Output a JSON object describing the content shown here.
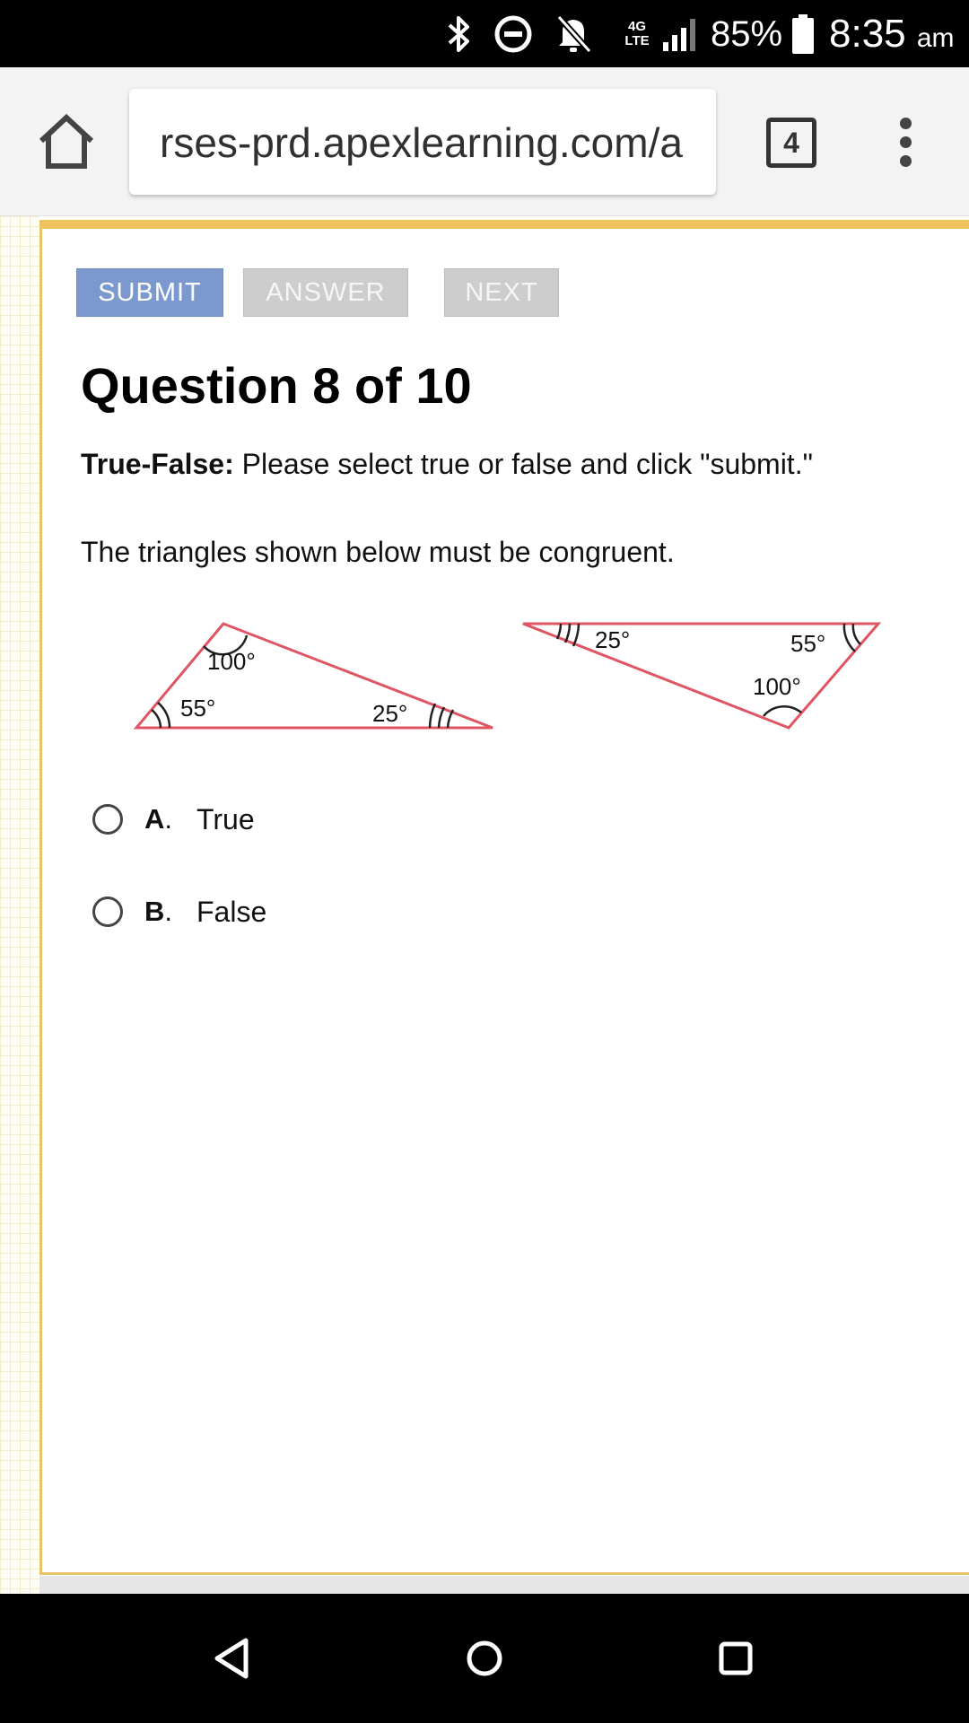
{
  "status_bar": {
    "network": "4G LTE",
    "battery": "85%",
    "time": "8:35",
    "ampm": "am"
  },
  "browser": {
    "url": "rses-prd.apexlearning.com/a",
    "tab_count": "4"
  },
  "toolbar": {
    "submit_label": "SUBMIT",
    "answer_label": "ANSWER",
    "next_label": "NEXT"
  },
  "question": {
    "title": "Question 8 of 10",
    "instruction_label": "True-False:",
    "instruction_text": " Please select true or false and click \"submit.\"",
    "prompt": "The triangles shown below must be congruent."
  },
  "figure": {
    "triangle_1": {
      "top_angle": "100°",
      "left_angle": "55°",
      "right_angle": "25°"
    },
    "triangle_2": {
      "left_angle": "25°",
      "right_angle": "55°",
      "bottom_angle": "100°"
    },
    "line_color": "#e05563"
  },
  "options": [
    {
      "letter": "A",
      "text": "True"
    },
    {
      "letter": "B",
      "text": "False"
    }
  ]
}
